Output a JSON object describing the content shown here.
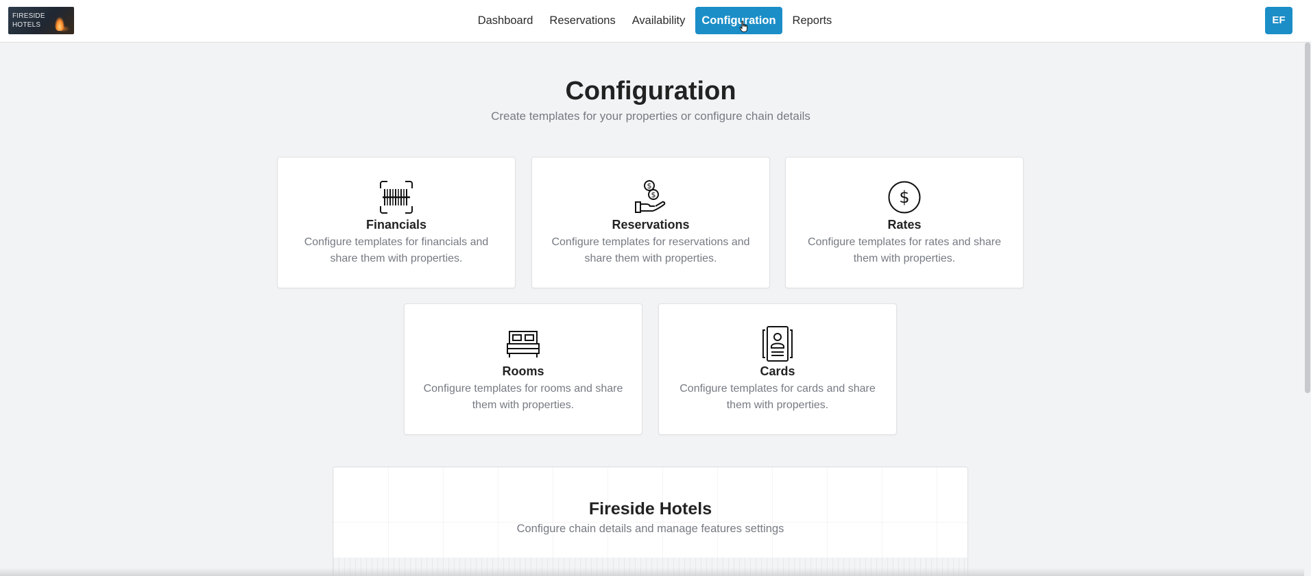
{
  "brand": {
    "logo_text": "FIRESIDE HOTELS",
    "logo_line1": "FIRESIDE",
    "logo_line2": "HOTELS"
  },
  "nav": {
    "items": [
      {
        "label": "Dashboard"
      },
      {
        "label": "Reservations"
      },
      {
        "label": "Availability"
      },
      {
        "label": "Configuration"
      },
      {
        "label": "Reports"
      }
    ],
    "active": "Configuration"
  },
  "user": {
    "initials": "EF"
  },
  "page": {
    "title": "Configuration",
    "subtitle": "Create templates for your properties or configure chain details"
  },
  "cards": [
    {
      "icon": "barcode-icon",
      "title": "Financials",
      "description": "Configure templates for financials and share them with properties."
    },
    {
      "icon": "hand-coins-icon",
      "title": "Reservations",
      "description": "Configure templates for reservations and share them with properties."
    },
    {
      "icon": "dollar-circle-icon",
      "title": "Rates",
      "description": "Configure templates for rates and share them with properties."
    },
    {
      "icon": "bed-icon",
      "title": "Rooms",
      "description": "Configure templates for rooms and share them with properties."
    },
    {
      "icon": "id-card-icon",
      "title": "Cards",
      "description": "Configure templates for cards and share them with properties."
    }
  ],
  "chain": {
    "title": "Fireside Hotels",
    "subtitle": "Configure chain details and manage features settings"
  },
  "colors": {
    "accent": "#1b8ec7",
    "background": "#f2f3f5",
    "muted_text": "#767a82"
  }
}
